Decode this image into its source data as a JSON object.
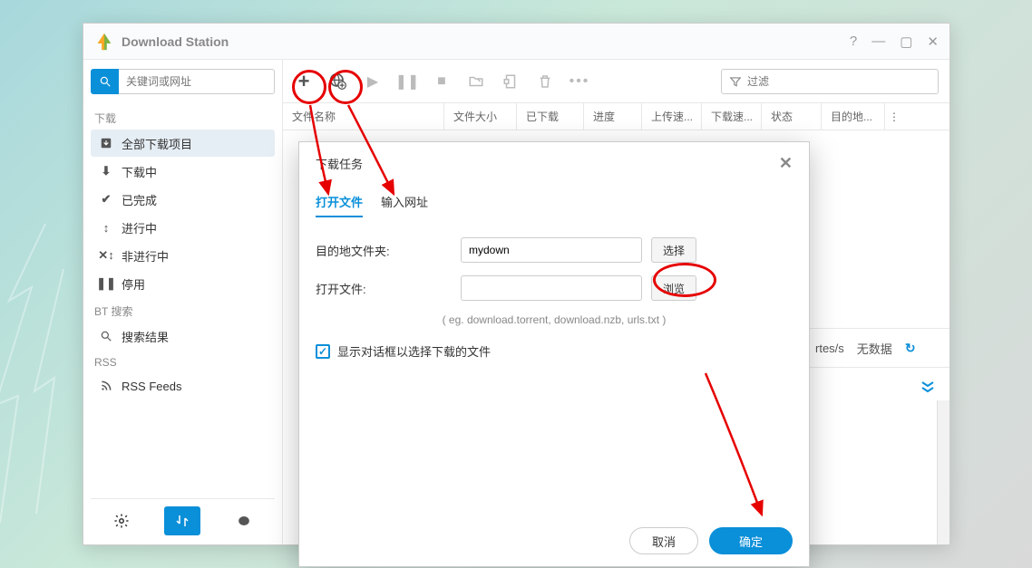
{
  "titlebar": {
    "title": "Download Station"
  },
  "sidebar": {
    "search_placeholder": "关键词或网址",
    "section_download": "下载",
    "items": [
      {
        "label": "全部下载项目",
        "icon": "↓"
      },
      {
        "label": "下载中",
        "icon": "⬇"
      },
      {
        "label": "已完成",
        "icon": "✔"
      },
      {
        "label": "进行中",
        "icon": "↕"
      },
      {
        "label": "非进行中",
        "icon": "⇅"
      },
      {
        "label": "停用",
        "icon": "❚❚"
      }
    ],
    "section_bt": "BT 搜索",
    "bt_item": "搜索结果",
    "section_rss": "RSS",
    "rss_item": "RSS Feeds"
  },
  "toolbar": {
    "filter_placeholder": "过滤"
  },
  "columns": [
    "文件名称",
    "文件大小",
    "已下载",
    "进度",
    "上传速...",
    "下载速...",
    "状态",
    "目的地...",
    "⋮"
  ],
  "status": {
    "rate": "rtes/s",
    "nodata": "无数据"
  },
  "dialog": {
    "title": "下载任务",
    "tab_open": "打开文件",
    "tab_url": "输入网址",
    "dest_label": "目的地文件夹:",
    "dest_value": "mydown",
    "dest_btn": "选择",
    "open_label": "打开文件:",
    "browse_btn": "浏览",
    "hint": "( eg. download.torrent, download.nzb, urls.txt )",
    "checkbox": "显示对话框以选择下载的文件",
    "cancel": "取消",
    "ok": "确定"
  }
}
